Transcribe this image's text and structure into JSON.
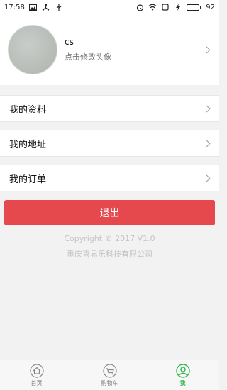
{
  "status_bar": {
    "time": "17:58",
    "battery_level": "92",
    "battery_fraction": 0.92,
    "left_icons": [
      "image-icon",
      "usb-tree-icon",
      "usb-icon"
    ],
    "right_icons": [
      "alarm-icon",
      "wifi-icon",
      "square-icon",
      "charging-icon"
    ]
  },
  "profile": {
    "username": "cs",
    "change_avatar": "点击修改头像"
  },
  "menu": {
    "items": [
      {
        "label": "我的资料"
      },
      {
        "label": "我的地址"
      },
      {
        "label": "我的订单"
      }
    ]
  },
  "logout": {
    "label": "退出"
  },
  "footer": {
    "copyright": "Copyright © 2017 V1.0",
    "company": "重庆喜易乐科技有限公司"
  },
  "bottom_nav": {
    "items": [
      {
        "label": "首页",
        "icon": "home-icon"
      },
      {
        "label": "购物车",
        "icon": "cart-icon"
      },
      {
        "label": "我",
        "icon": "user-icon",
        "active": true
      }
    ]
  },
  "colors": {
    "accent": "#2fb54a",
    "logout": "#e5484d"
  }
}
